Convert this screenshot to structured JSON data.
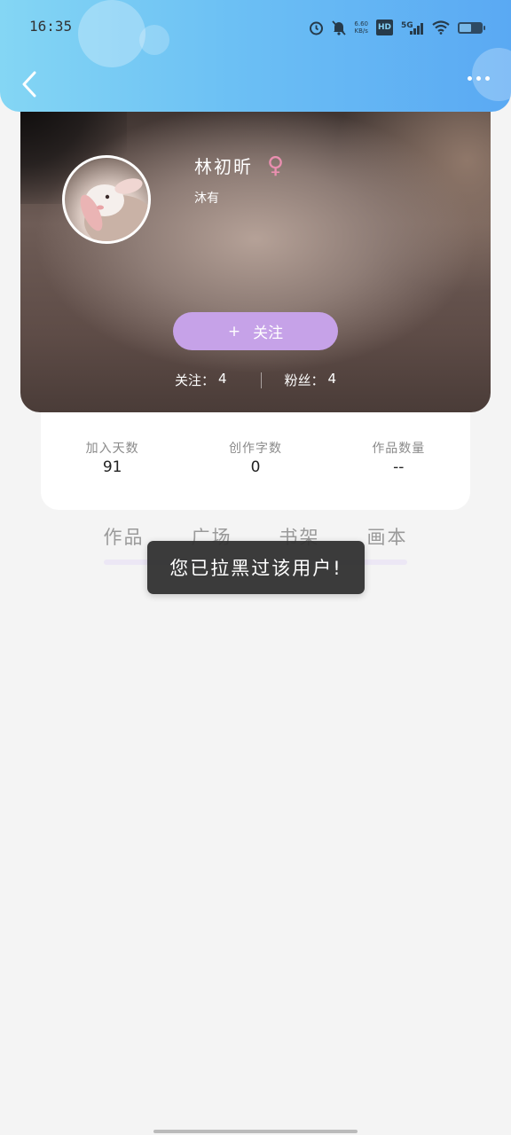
{
  "status_bar": {
    "time": "16:35",
    "net_speed_value": "6.60",
    "net_speed_unit": "KB/s",
    "hd_label": "HD",
    "signal_label": "5G",
    "icons": [
      "alarm-icon",
      "mute-icon",
      "hd-icon",
      "signal-5g-icon",
      "wifi-icon",
      "battery-icon"
    ]
  },
  "header": {
    "back_icon": "chevron-left-icon",
    "more_icon": "more-dots-icon"
  },
  "profile": {
    "username": "林初昕",
    "gender_symbol": "♀",
    "signature": "沐有",
    "follow_button": {
      "icon": "+",
      "label": "关注"
    },
    "following_label": "关注：",
    "following_count": "4",
    "fans_label": "粉丝：",
    "fans_count": "4"
  },
  "stats": [
    {
      "label": "加入天数",
      "value": "91"
    },
    {
      "label": "创作字数",
      "value": "0"
    },
    {
      "label": "作品数量",
      "value": "--"
    }
  ],
  "tabs": [
    "作品",
    "广场",
    "书架",
    "画本"
  ],
  "toast": {
    "message": "您已拉黑过该用户!"
  },
  "colors": {
    "header_start": "#84d6f4",
    "header_end": "#5aa9f3",
    "follow_button": "#c6a2e8",
    "gender_icon": "#ea8fb0",
    "toast_bg": "#303030",
    "page_bg": "#f4f4f4"
  }
}
